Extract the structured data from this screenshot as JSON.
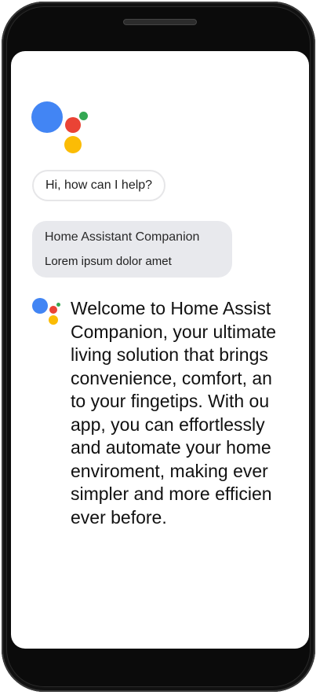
{
  "assistant": {
    "logo_icon": "google-assistant-logo-icon",
    "greeting": "Hi, how can I help?",
    "card": {
      "title": "Home Assistant Companion",
      "subtitle": "Lorem ipsum dolor amet"
    },
    "message_lines": [
      "Welcome to Home Assist",
      "Companion, your ultimate",
      "living solution that brings",
      "convenience, comfort, an",
      "to your fingetips. With ou",
      "app, you can effortlessly",
      "and automate your home",
      "enviroment, making ever",
      "simpler and more efficien",
      "ever before."
    ]
  },
  "colors": {
    "blue": "#4285F4",
    "red": "#EA4335",
    "yellow": "#FBBC05",
    "green": "#34A853",
    "card_bg": "#e8e9ed"
  }
}
